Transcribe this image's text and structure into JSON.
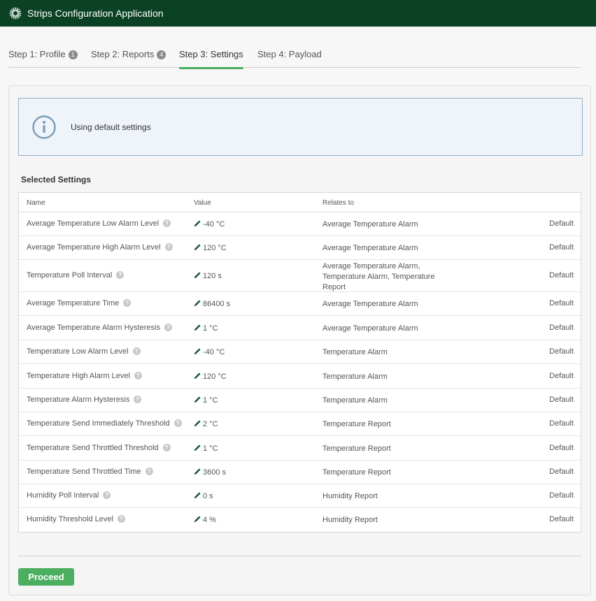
{
  "app": {
    "title": "Strips Configuration Application",
    "logo_icon": "sunburst-logo-icon"
  },
  "tabs": [
    {
      "label": "Step 1: Profile",
      "badge": "1"
    },
    {
      "label": "Step 2: Reports",
      "badge": "4"
    },
    {
      "label": "Step 3: Settings",
      "badge": ""
    },
    {
      "label": "Step 4: Payload",
      "badge": ""
    }
  ],
  "active_tab": "Step 3: Settings",
  "info": {
    "message": "Using default settings",
    "icon": "info-icon"
  },
  "section": {
    "title": "Selected Settings"
  },
  "table": {
    "headers": {
      "name": "Name",
      "value": "Value",
      "relates": "Relates to"
    },
    "rows": [
      {
        "name": "Average Temperature Low Alarm Level",
        "value": "-40 °C",
        "relates": "Average Temperature Alarm",
        "status": "Default"
      },
      {
        "name": "Average Temperature High Alarm Level",
        "value": "120 °C",
        "relates": "Average Temperature Alarm",
        "status": "Default"
      },
      {
        "name": "Temperature Poll Interval",
        "value": "120 s",
        "relates": "Average Temperature Alarm, Temperature Alarm, Temperature Report",
        "status": "Default"
      },
      {
        "name": "Average Temperature Time",
        "value": "86400 s",
        "relates": "Average Temperature Alarm",
        "status": "Default"
      },
      {
        "name": "Average Temperature Alarm Hysteresis",
        "value": "1 °C",
        "relates": "Average Temperature Alarm",
        "status": "Default"
      },
      {
        "name": "Temperature Low Alarm Level",
        "value": "-40 °C",
        "relates": "Temperature Alarm",
        "status": "Default"
      },
      {
        "name": "Temperature High Alarm Level",
        "value": "120 °C",
        "relates": "Temperature Alarm",
        "status": "Default"
      },
      {
        "name": "Temperature Alarm Hysteresis",
        "value": "1 °C",
        "relates": "Temperature Alarm",
        "status": "Default"
      },
      {
        "name": "Temperature Send Immediately Threshold",
        "value": "2 °C",
        "relates": "Temperature Report",
        "status": "Default"
      },
      {
        "name": "Temperature Send Throttled Threshold",
        "value": "1 °C",
        "relates": "Temperature Report",
        "status": "Default"
      },
      {
        "name": "Temperature Send Throttled Time",
        "value": "3600 s",
        "relates": "Temperature Report",
        "status": "Default"
      },
      {
        "name": "Humidity Poll Interval",
        "value": "0 s",
        "relates": "Humidity Report",
        "status": "Default"
      },
      {
        "name": "Humidity Threshold Level",
        "value": "4 %",
        "relates": "Humidity Report",
        "status": "Default"
      }
    ]
  },
  "actions": {
    "proceed_label": "Proceed"
  },
  "colors": {
    "header_bg": "#0b4226",
    "accent_green": "#4cae60",
    "info_border": "#8fb0cc",
    "info_bg": "#eef4f9"
  }
}
